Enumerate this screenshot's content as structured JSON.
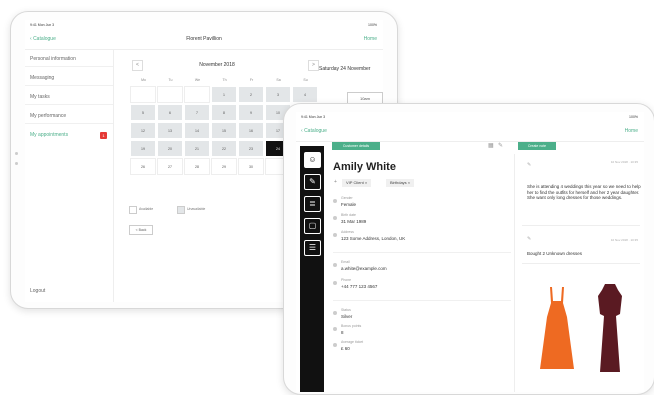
{
  "back_tablet": {
    "status": {
      "left": "9:41  Mon Jun 3",
      "right": "100%"
    },
    "nav": {
      "back": "Catalogue",
      "title": "Florent Pavillion",
      "right": "Home"
    },
    "menu": [
      {
        "label": "Personal information"
      },
      {
        "label": "Messaging"
      },
      {
        "label": "My tasks"
      },
      {
        "label": "My performance"
      },
      {
        "label": "My appointments",
        "badge": "1"
      }
    ],
    "logout": "Logout",
    "calendar": {
      "title": "November 2018",
      "prev": "<",
      "next": ">",
      "day_names": [
        "Mo",
        "Tu",
        "We",
        "Th",
        "Fr",
        "Sa",
        "Su"
      ],
      "weeks": [
        [
          "",
          "",
          "",
          "1",
          "2",
          "3",
          "4"
        ],
        [
          "5",
          "6",
          "7",
          "8",
          "9",
          "10",
          "11"
        ],
        [
          "12",
          "13",
          "14",
          "15",
          "16",
          "17",
          "18"
        ],
        [
          "19",
          "20",
          "21",
          "22",
          "23",
          "24",
          "25"
        ],
        [
          "26",
          "27",
          "28",
          "29",
          "30",
          "",
          ""
        ]
      ],
      "selected_day": "24"
    },
    "legend": {
      "available": "Available",
      "unavailable": "Unavailable"
    },
    "back_button": "< Back",
    "side_date": "Saturday 24 November",
    "side_button": "10am"
  },
  "front_tablet": {
    "status": {
      "left": "9:41  Mon Jun 3",
      "right": "100%"
    },
    "nav": {
      "back": "Catalogue",
      "right": "Home"
    },
    "sidebar_icons": [
      "person-icon",
      "edit-icon",
      "list-icon",
      "bag-icon",
      "menu-icon"
    ],
    "profile_button": "Customer details",
    "notes_button": "Create note",
    "customer": {
      "name": "Amily White",
      "tags": [
        "VIP Client",
        "Birthdays"
      ],
      "fields": [
        {
          "label": "Gender",
          "value": "Female"
        },
        {
          "label": "Birth date",
          "value": "31 Mar 1989"
        },
        {
          "label": "Address",
          "value": "123 Some Address, London, UK"
        },
        {
          "label": "Email",
          "value": "a.white@example.com"
        },
        {
          "label": "Phone",
          "value": "+44 777 123 4567"
        },
        {
          "label": "Status",
          "value": "Silver"
        },
        {
          "label": "Bonus points",
          "value": "8"
        },
        {
          "label": "Average ticket",
          "value": "£ 60"
        }
      ]
    },
    "notes": [
      {
        "meta": "10 Nov 2018 · 10:35",
        "text": "She is attending 4 weddings this year so we need to help her to find the outfits for herself and her 2 year daughter. She want only long dresses for those weddings."
      },
      {
        "meta": "10 Nov 2018 · 10:35",
        "text": "Bought 2 Unknown dresses"
      }
    ],
    "colors": {
      "accent": "#4caf8a",
      "dress_orange": "#ee6a22",
      "dress_burgundy": "#5a1a22"
    }
  }
}
